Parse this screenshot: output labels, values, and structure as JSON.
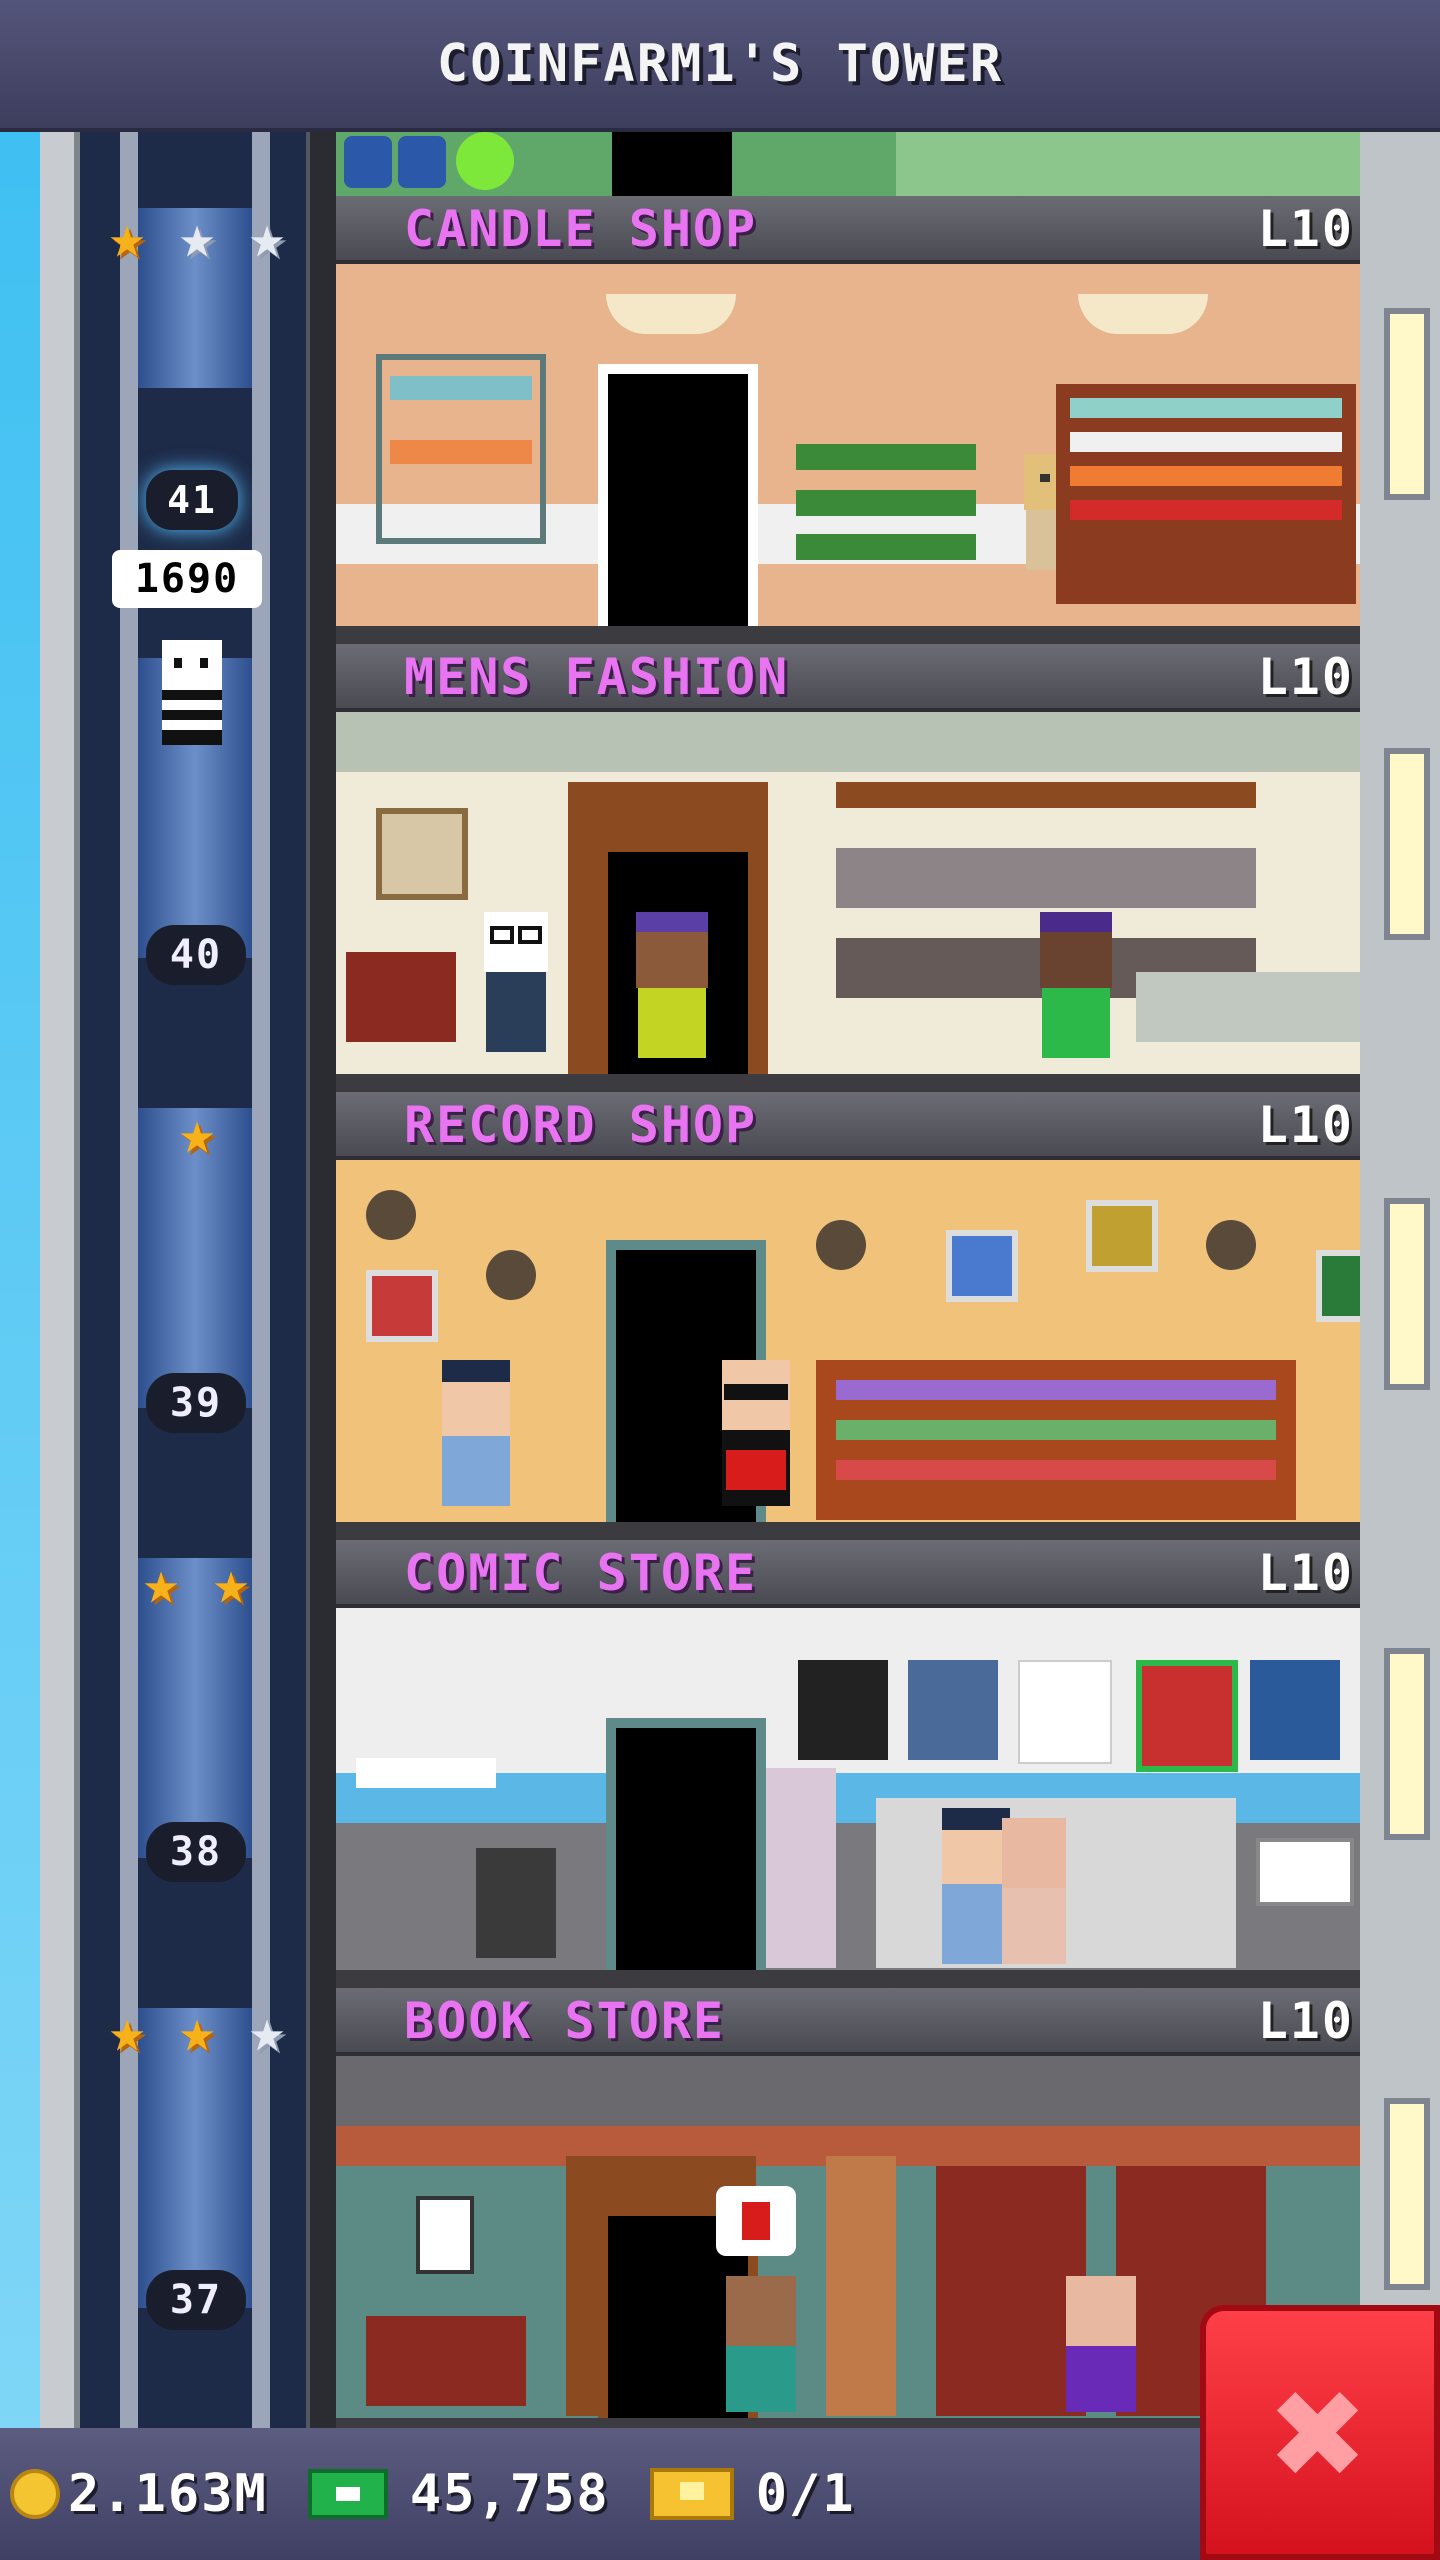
{
  "header": {
    "title": "COINFARM1'S TOWER"
  },
  "elevator": {
    "current_floor": "41",
    "coins_label": "1690"
  },
  "floors": [
    {
      "name": "CANDLE SHOP",
      "level": "L10",
      "number": "",
      "stars_gold": 1,
      "stars_silver": 2
    },
    {
      "name": "MENS FASHION",
      "level": "L10",
      "number": "40",
      "stars_gold": 0,
      "stars_silver": 0
    },
    {
      "name": "RECORD SHOP",
      "level": "L10",
      "number": "39",
      "stars_gold": 1,
      "stars_silver": 0
    },
    {
      "name": "COMIC STORE",
      "level": "L10",
      "number": "38",
      "stars_gold": 2,
      "stars_silver": 0
    },
    {
      "name": "BOOK STORE",
      "level": "L10",
      "number": "37",
      "stars_gold": 2,
      "stars_silver": 1
    }
  ],
  "bottom": {
    "coins": "2.163M",
    "bux": "45,758",
    "tickets": "0/1"
  },
  "colors": {
    "floor_name": "#e874f2",
    "close_button": "#e8202a"
  }
}
